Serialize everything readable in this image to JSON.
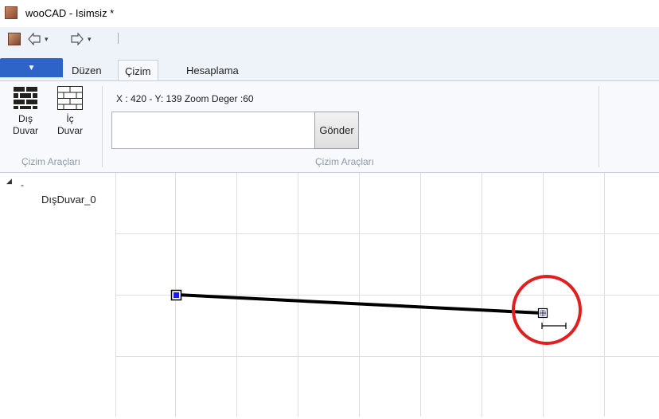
{
  "window": {
    "title": "wooCAD - Isimsiz *",
    "app_icon": "woocad-app-icon"
  },
  "quick_access": {
    "app_icon": "woocad-small-icon",
    "undo_icon": "undo-icon",
    "redo_icon": "redo-icon",
    "dropdown_caret": "▾"
  },
  "ribbon": {
    "app_menu_caret": "▼",
    "tabs": [
      {
        "label": "Düzen",
        "selected": false
      },
      {
        "label": "Çizim",
        "selected": true
      },
      {
        "label": "Hesaplama",
        "selected": false
      }
    ],
    "groups": [
      {
        "label": "Çizim Araçları",
        "buttons": [
          {
            "label": "Dış Duvar",
            "icon": "brick-wall-dark-icon"
          },
          {
            "label": "İç Duvar",
            "icon": "brick-wall-light-icon"
          }
        ]
      },
      {
        "label": "Çizim Araçları",
        "coord_readout": "X : 420   -  Y: 139 Zoom Deger :60",
        "command_input": {
          "value": "",
          "placeholder": ""
        },
        "send_button": "Gönder"
      }
    ]
  },
  "tree": {
    "expander": "◢",
    "root_label": "-",
    "children": [
      "DışDuvar_0"
    ]
  },
  "canvas": {
    "wall": {
      "name": "DışDuvar_0"
    },
    "highlight_color": "#e02020",
    "wall_color": "#000000",
    "handle_color": "#1a1aff",
    "grid_color": "#dedede"
  }
}
